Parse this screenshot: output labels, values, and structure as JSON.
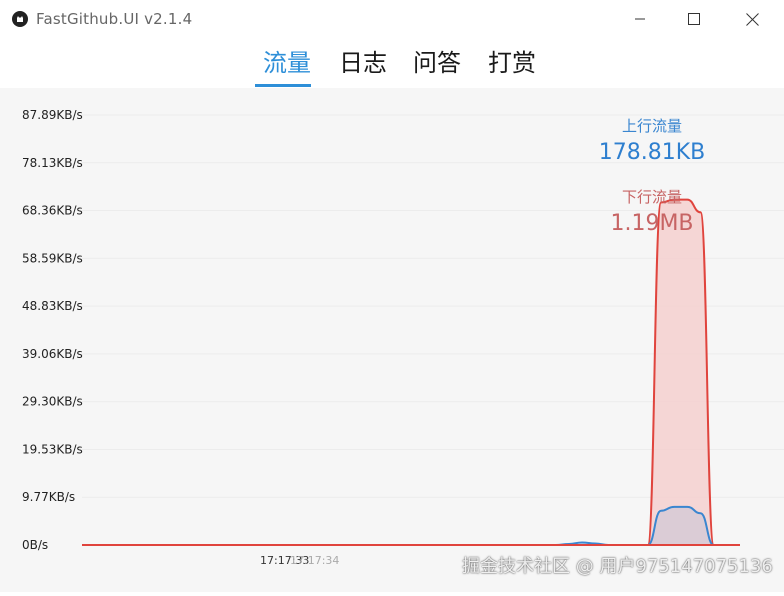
{
  "window": {
    "title": "FastGithub.UI v2.1.4"
  },
  "icons": {
    "app": "github-cat-icon",
    "minimize": "minimize-icon",
    "maximize": "maximize-icon",
    "close": "close-icon"
  },
  "tabs": [
    {
      "label": "流量",
      "active": true
    },
    {
      "label": "日志",
      "active": false
    },
    {
      "label": "问答",
      "active": false
    },
    {
      "label": "打赏",
      "active": false
    }
  ],
  "legend": {
    "upload_label": "上行流量",
    "upload_value": "178.81KB",
    "download_label": "下行流量",
    "download_value": "1.19MB"
  },
  "colors": {
    "accent": "#2e8fd8",
    "upload": "#3a86d0",
    "download": "#e0443d",
    "download_fill": "#f5d0cf",
    "legend_down_text": "#c76464"
  },
  "chart_data": {
    "type": "area",
    "y_unit": "KB/s",
    "ylim": [
      0,
      87.89
    ],
    "y_ticks": [
      "87.89KB/s",
      "78.13KB/s",
      "68.36KB/s",
      "58.59KB/s",
      "48.83KB/s",
      "39.06KB/s",
      "29.30KB/s",
      "19.53KB/s",
      "9.77KB/s",
      "0B/s"
    ],
    "x_tick_labels": [
      "17:17:33",
      "17:17:34"
    ],
    "x": [
      0,
      0.1,
      0.2,
      0.3,
      0.4,
      0.5,
      0.52,
      0.54,
      0.56,
      0.58,
      0.6,
      0.62,
      0.64,
      0.66,
      0.68,
      0.7,
      0.72,
      0.74,
      0.76,
      0.78,
      0.8,
      0.82,
      0.84,
      0.86,
      0.88,
      0.9,
      0.92,
      0.94,
      0.96,
      0.98,
      1.0
    ],
    "series": [
      {
        "name": "上行流量",
        "values": [
          0,
          0,
          0,
          0,
          0,
          0,
          0,
          0,
          0,
          0,
          0,
          0,
          0,
          0,
          0,
          0,
          0,
          0.2,
          0.5,
          0.3,
          0,
          0,
          0,
          0,
          7.0,
          7.8,
          7.8,
          6.5,
          0,
          0,
          0
        ]
      },
      {
        "name": "下行流量",
        "values": [
          0,
          0,
          0,
          0,
          0,
          0,
          0,
          0,
          0,
          0,
          0,
          0,
          0,
          0,
          0,
          0,
          0,
          0,
          0,
          0,
          0,
          0,
          0,
          0,
          70.0,
          70.6,
          70.6,
          68.0,
          0,
          0,
          0
        ]
      }
    ]
  },
  "watermark": "掘金技术社区 @ 用户975147075136"
}
